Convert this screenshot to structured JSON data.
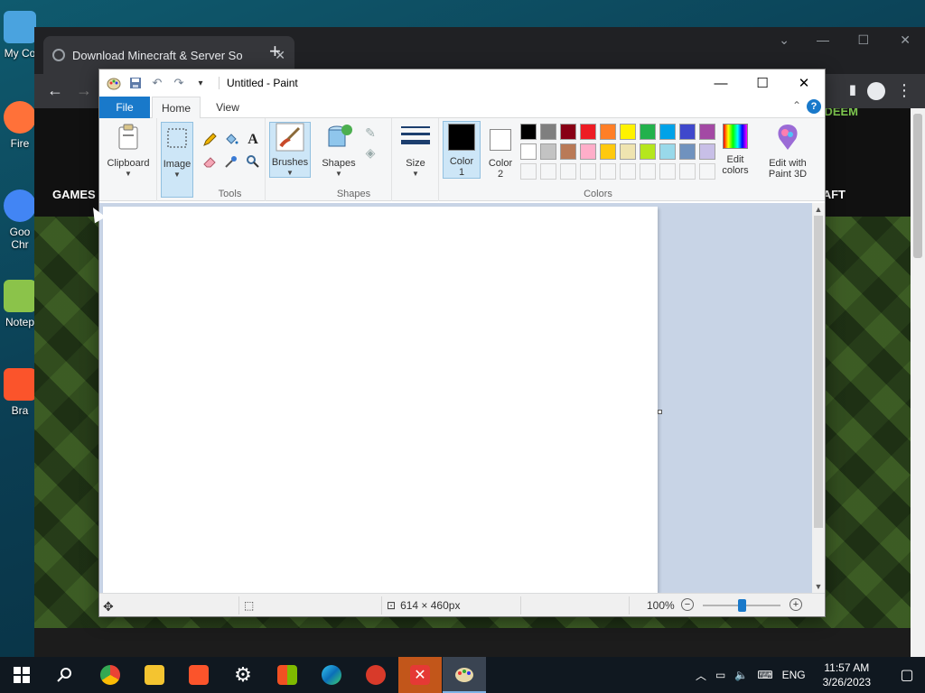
{
  "desktop": {
    "icons": [
      {
        "label": "My Co",
        "color": "#4aa3df"
      },
      {
        "label": "Fire",
        "color": "#ff7139"
      },
      {
        "label": "Goo Chr",
        "color": "#4285f4"
      },
      {
        "label": "Notep",
        "color": "#8bc34a"
      },
      {
        "label": "Bra",
        "color": "#fb542b"
      }
    ]
  },
  "browser": {
    "tab_title": "Download Minecraft & Server So",
    "tab_close": "✕",
    "new_tab": "+",
    "page": {
      "nav_games": "GAMES",
      "redeem": "REDEEM",
      "nav_craft": "AFT"
    }
  },
  "paint": {
    "title": "Untitled - Paint",
    "tabs": {
      "file": "File",
      "home": "Home",
      "view": "View"
    },
    "help": "?",
    "groups": {
      "clipboard": "Clipboard",
      "image": "Image",
      "tools": "Tools",
      "brushes": "Brushes",
      "shapes_btn": "Shapes",
      "shapes_group": "Shapes",
      "size": "Size",
      "color1": "Color 1",
      "color2": "Color 2",
      "colors_group": "Colors",
      "edit_colors": "Edit colors",
      "edit_paint3d": "Edit with Paint 3D"
    },
    "color1_value": "#000000",
    "color2_value": "#ffffff",
    "palette_row1": [
      "#000000",
      "#7f7f7f",
      "#880015",
      "#ed1c24",
      "#ff7f27",
      "#fff200",
      "#22b14c",
      "#00a2e8",
      "#3f48cc",
      "#a349a4"
    ],
    "palette_row2": [
      "#ffffff",
      "#c3c3c3",
      "#b97a57",
      "#ffaec9",
      "#ffc90e",
      "#efe4b0",
      "#b5e61d",
      "#99d9ea",
      "#7092be",
      "#c8bfe7"
    ],
    "status": {
      "dimensions": "614 × 460px",
      "zoom": "100%",
      "zoom_level": 0.5
    }
  },
  "taskbar": {
    "language": "ENG",
    "time": "11:57 AM",
    "date": "3/26/2023"
  }
}
